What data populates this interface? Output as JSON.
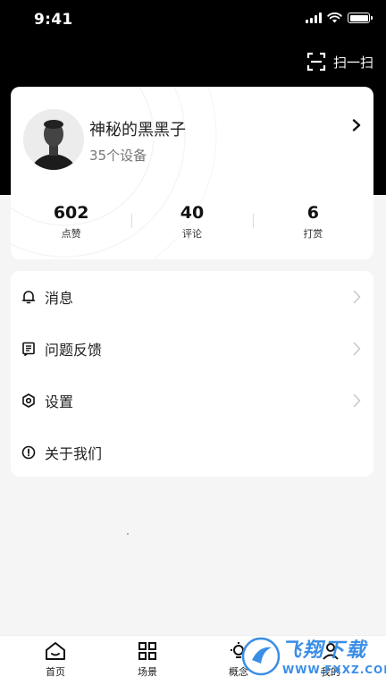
{
  "status_bar": {
    "time": "9:41"
  },
  "header": {
    "scan_label": "扫一扫",
    "background_color": "#000000"
  },
  "profile": {
    "name": "神秘的黑黑子",
    "devices": "35个设备",
    "stats": [
      {
        "value": "602",
        "label": "点赞"
      },
      {
        "value": "40",
        "label": "评论"
      },
      {
        "value": "6",
        "label": "打赏"
      }
    ]
  },
  "menu": {
    "items": [
      {
        "label": "消息",
        "icon": "bell-icon",
        "has_arrow": true
      },
      {
        "label": "问题反馈",
        "icon": "feedback-icon",
        "has_arrow": true
      },
      {
        "label": "设置",
        "icon": "settings-icon",
        "has_arrow": true
      },
      {
        "label": "关于我们",
        "icon": "info-icon",
        "has_arrow": false
      }
    ]
  },
  "tabbar": {
    "tabs": [
      {
        "label": "首页",
        "icon": "home-icon"
      },
      {
        "label": "场景",
        "icon": "grid-icon"
      },
      {
        "label": "概念",
        "icon": "bulb-icon"
      },
      {
        "label": "我的",
        "icon": "person-icon"
      }
    ]
  },
  "watermark": {
    "text": "飞翔下载",
    "url": "WWW.FXXZ.COM",
    "color": "#3a8ee6"
  }
}
